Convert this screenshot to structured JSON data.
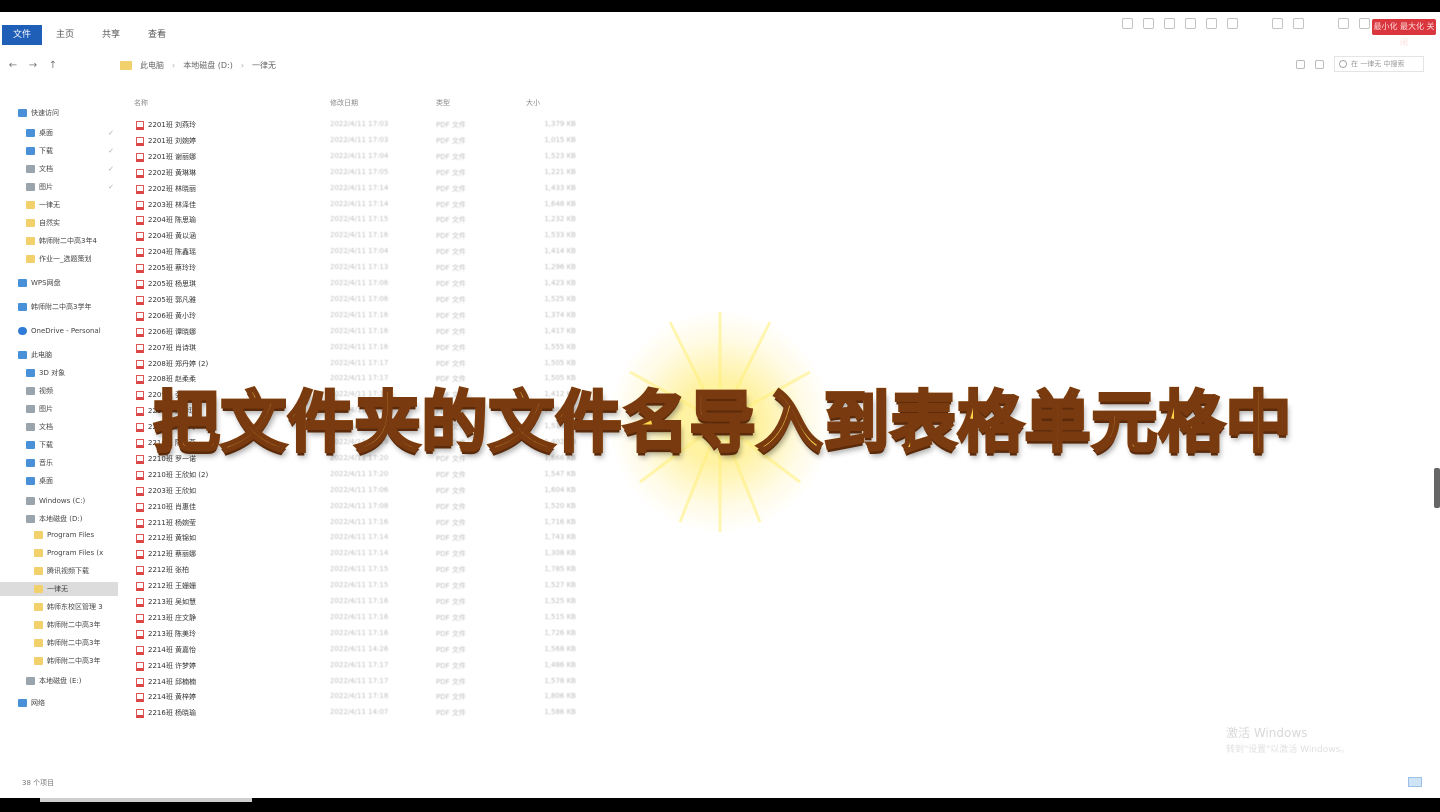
{
  "ribbon": {
    "tabs": [
      "文件",
      "主页",
      "共享",
      "查看"
    ],
    "window_button": "最小化 最大化 关闭"
  },
  "address": {
    "crumbs": [
      "此电脑",
      "本地磁盘 (D:)",
      "一律无"
    ],
    "search_placeholder": "在 一律无 中搜索"
  },
  "headers": {
    "name": "名称",
    "date": "修改日期",
    "type": "类型",
    "size": "大小"
  },
  "sidebar": [
    {
      "label": "快速访问",
      "icon": "star",
      "color": "blue",
      "indent": 0,
      "pin": false
    },
    {
      "label": "桌面",
      "icon": "desktop",
      "color": "blue",
      "indent": 1,
      "pin": true
    },
    {
      "label": "下载",
      "icon": "download",
      "color": "blue",
      "indent": 1,
      "pin": true
    },
    {
      "label": "文档",
      "icon": "document",
      "color": "gray",
      "indent": 1,
      "pin": true
    },
    {
      "label": "图片",
      "icon": "picture",
      "color": "gray",
      "indent": 1,
      "pin": true
    },
    {
      "label": "一律无",
      "icon": "folder",
      "color": "yellow",
      "indent": 1,
      "pin": false
    },
    {
      "label": "自然实",
      "icon": "folder",
      "color": "yellow",
      "indent": 1,
      "pin": false
    },
    {
      "label": "韩师附二中高3年4",
      "icon": "folder",
      "color": "yellow",
      "indent": 1,
      "pin": false
    },
    {
      "label": "作业一_选题策划",
      "icon": "folder",
      "color": "yellow",
      "indent": 1,
      "pin": false
    },
    {
      "label": "WPS网盘",
      "icon": "cloud",
      "color": "blue",
      "indent": 0,
      "pin": false
    },
    {
      "label": "韩师附二中高3学年",
      "icon": "cloud",
      "color": "blue",
      "indent": 0,
      "pin": false
    },
    {
      "label": "OneDrive - Personal",
      "icon": "cloud",
      "color": "cloud",
      "indent": 0,
      "pin": false
    },
    {
      "label": "此电脑",
      "icon": "computer",
      "color": "blue",
      "indent": 0,
      "pin": false
    },
    {
      "label": "3D 对象",
      "icon": "cube",
      "color": "blue",
      "indent": 1,
      "pin": false
    },
    {
      "label": "视频",
      "icon": "video",
      "color": "gray",
      "indent": 1,
      "pin": false
    },
    {
      "label": "图片",
      "icon": "picture",
      "color": "gray",
      "indent": 1,
      "pin": false
    },
    {
      "label": "文档",
      "icon": "document",
      "color": "gray",
      "indent": 1,
      "pin": false
    },
    {
      "label": "下载",
      "icon": "download",
      "color": "blue",
      "indent": 1,
      "pin": false
    },
    {
      "label": "音乐",
      "icon": "music",
      "color": "blue",
      "indent": 1,
      "pin": false
    },
    {
      "label": "桌面",
      "icon": "desktop",
      "color": "blue",
      "indent": 1,
      "pin": false
    },
    {
      "label": "Windows (C:)",
      "icon": "drive",
      "color": "gray",
      "indent": 1,
      "pin": false
    },
    {
      "label": "本地磁盘 (D:)",
      "icon": "drive",
      "color": "gray",
      "indent": 1,
      "pin": false
    },
    {
      "label": "Program Files",
      "icon": "folder",
      "color": "yellow",
      "indent": 2,
      "pin": false
    },
    {
      "label": "Program Files (x",
      "icon": "folder",
      "color": "yellow",
      "indent": 2,
      "pin": false
    },
    {
      "label": "腾讯视频下载",
      "icon": "folder",
      "color": "yellow",
      "indent": 2,
      "pin": false
    },
    {
      "label": "一律无",
      "icon": "folder",
      "color": "yellow",
      "indent": 2,
      "pin": false,
      "selected": true
    },
    {
      "label": "韩师东校区管理 3",
      "icon": "folder",
      "color": "yellow",
      "indent": 2,
      "pin": false
    },
    {
      "label": "韩师附二中高3年",
      "icon": "folder",
      "color": "yellow",
      "indent": 2,
      "pin": false
    },
    {
      "label": "韩师附二中高3年",
      "icon": "folder",
      "color": "yellow",
      "indent": 2,
      "pin": false
    },
    {
      "label": "韩师附二中高3年",
      "icon": "folder",
      "color": "yellow",
      "indent": 2,
      "pin": false
    },
    {
      "label": "本地磁盘 (E:)",
      "icon": "drive",
      "color": "gray",
      "indent": 1,
      "pin": false
    },
    {
      "label": "网络",
      "icon": "network",
      "color": "blue",
      "indent": 0,
      "pin": false
    }
  ],
  "files": [
    {
      "name": "2201班 刘燕玲",
      "date": "2022/4/11 17:03",
      "type": "PDF 文件",
      "size": "1,379 KB"
    },
    {
      "name": "2201班 刘婉婷",
      "date": "2022/4/11 17:03",
      "type": "PDF 文件",
      "size": "1,015 KB"
    },
    {
      "name": "2201班 谢丽娜",
      "date": "2022/4/11 17:04",
      "type": "PDF 文件",
      "size": "1,523 KB"
    },
    {
      "name": "2202班 黄琳琳",
      "date": "2022/4/11 17:05",
      "type": "PDF 文件",
      "size": "1,221 KB"
    },
    {
      "name": "2202班 林晓丽",
      "date": "2022/4/11 17:14",
      "type": "PDF 文件",
      "size": "1,433 KB"
    },
    {
      "name": "2203班 林泽佳",
      "date": "2022/4/11 17:14",
      "type": "PDF 文件",
      "size": "1,648 KB"
    },
    {
      "name": "2204班 陈思瑜",
      "date": "2022/4/11 17:15",
      "type": "PDF 文件",
      "size": "1,232 KB"
    },
    {
      "name": "2204班 黄以涵",
      "date": "2022/4/11 17:16",
      "type": "PDF 文件",
      "size": "1,533 KB"
    },
    {
      "name": "2204班 陈鑫瑶",
      "date": "2022/4/11 17:04",
      "type": "PDF 文件",
      "size": "1,414 KB"
    },
    {
      "name": "2205班 蔡玲玲",
      "date": "2022/4/11 17:13",
      "type": "PDF 文件",
      "size": "1,296 KB"
    },
    {
      "name": "2205班 杨思琪",
      "date": "2022/4/11 17:06",
      "type": "PDF 文件",
      "size": "1,423 KB"
    },
    {
      "name": "2205班 郭凡雅",
      "date": "2022/4/11 17:06",
      "type": "PDF 文件",
      "size": "1,525 KB"
    },
    {
      "name": "2206班 黄小玲",
      "date": "2022/4/11 17:16",
      "type": "PDF 文件",
      "size": "1,374 KB"
    },
    {
      "name": "2206班 谭晓娜",
      "date": "2022/4/11 17:16",
      "type": "PDF 文件",
      "size": "1,417 KB"
    },
    {
      "name": "2207班 肖诗琪",
      "date": "2022/4/11 17:16",
      "type": "PDF 文件",
      "size": "1,555 KB"
    },
    {
      "name": "2208班 郑丹婷 (2)",
      "date": "2022/4/11 17:17",
      "type": "PDF 文件",
      "size": "1,505 KB"
    },
    {
      "name": "2208班 赵柔柔",
      "date": "2022/4/11 17:17",
      "type": "PDF 文件",
      "size": "1,505 KB"
    },
    {
      "name": "2209班 张晓琳",
      "date": "2022/4/11 17:18",
      "type": "PDF 文件",
      "size": "1,412 KB"
    },
    {
      "name": "2209班 郑诗琪",
      "date": "2022/4/11 17:18",
      "type": "PDF 文件",
      "size": "1,488 KB"
    },
    {
      "name": "2210班 黄曼玲",
      "date": "2022/4/11 17:19",
      "type": "PDF 文件",
      "size": "1,514 KB"
    },
    {
      "name": "2210班 陈小燕",
      "date": "2022/4/11 17:19",
      "type": "PDF 文件",
      "size": "1,402 KB"
    },
    {
      "name": "2210班 罗一诺",
      "date": "2022/4/11 17:20",
      "type": "PDF 文件",
      "size": "1,666 KB"
    },
    {
      "name": "2210班 王欣如 (2)",
      "date": "2022/4/11 17:20",
      "type": "PDF 文件",
      "size": "1,547 KB"
    },
    {
      "name": "2203班 王欣如",
      "date": "2022/4/11 17:06",
      "type": "PDF 文件",
      "size": "1,604 KB"
    },
    {
      "name": "2210班 肖惠佳",
      "date": "2022/4/11 17:08",
      "type": "PDF 文件",
      "size": "1,520 KB"
    },
    {
      "name": "2211班 杨婉莹",
      "date": "2022/4/11 17:16",
      "type": "PDF 文件",
      "size": "1,716 KB"
    },
    {
      "name": "2212班 黄锦如",
      "date": "2022/4/11 17:14",
      "type": "PDF 文件",
      "size": "1,743 KB"
    },
    {
      "name": "2212班 蔡丽娜",
      "date": "2022/4/11 17:14",
      "type": "PDF 文件",
      "size": "1,308 KB"
    },
    {
      "name": "2212班 张柏",
      "date": "2022/4/11 17:15",
      "type": "PDF 文件",
      "size": "1,785 KB"
    },
    {
      "name": "2212班 王姗姗",
      "date": "2022/4/11 17:15",
      "type": "PDF 文件",
      "size": "1,527 KB"
    },
    {
      "name": "2213班 吴如慧",
      "date": "2022/4/11 17:16",
      "type": "PDF 文件",
      "size": "1,525 KB"
    },
    {
      "name": "2213班 庄文静",
      "date": "2022/4/11 17:16",
      "type": "PDF 文件",
      "size": "1,515 KB"
    },
    {
      "name": "2213班 陈美玲",
      "date": "2022/4/11 17:16",
      "type": "PDF 文件",
      "size": "1,726 KB"
    },
    {
      "name": "2214班 黄嘉怡",
      "date": "2022/4/11 14:26",
      "type": "PDF 文件",
      "size": "1,568 KB"
    },
    {
      "name": "2214班 许梦婷",
      "date": "2022/4/11 17:17",
      "type": "PDF 文件",
      "size": "1,486 KB"
    },
    {
      "name": "2214班 邱楠楠",
      "date": "2022/4/11 17:17",
      "type": "PDF 文件",
      "size": "1,578 KB"
    },
    {
      "name": "2214班 黄梓婷",
      "date": "2022/4/11 17:18",
      "type": "PDF 文件",
      "size": "1,806 KB"
    },
    {
      "name": "2216班 杨晓瑜",
      "date": "2022/4/11 14:07",
      "type": "PDF 文件",
      "size": "1,586 KB"
    }
  ],
  "caption": "把文件夹的文件名导入到表格单元格中",
  "watermark": {
    "line1": "激活 Windows",
    "line2": "转到\"设置\"以激活 Windows。"
  },
  "status": "38 个项目",
  "colors": {
    "ribbon_file_tab": "#1f5fb8",
    "caption_fill": "#ffd64a",
    "caption_stroke": "#7a3a10",
    "close_button": "#d9363e"
  }
}
